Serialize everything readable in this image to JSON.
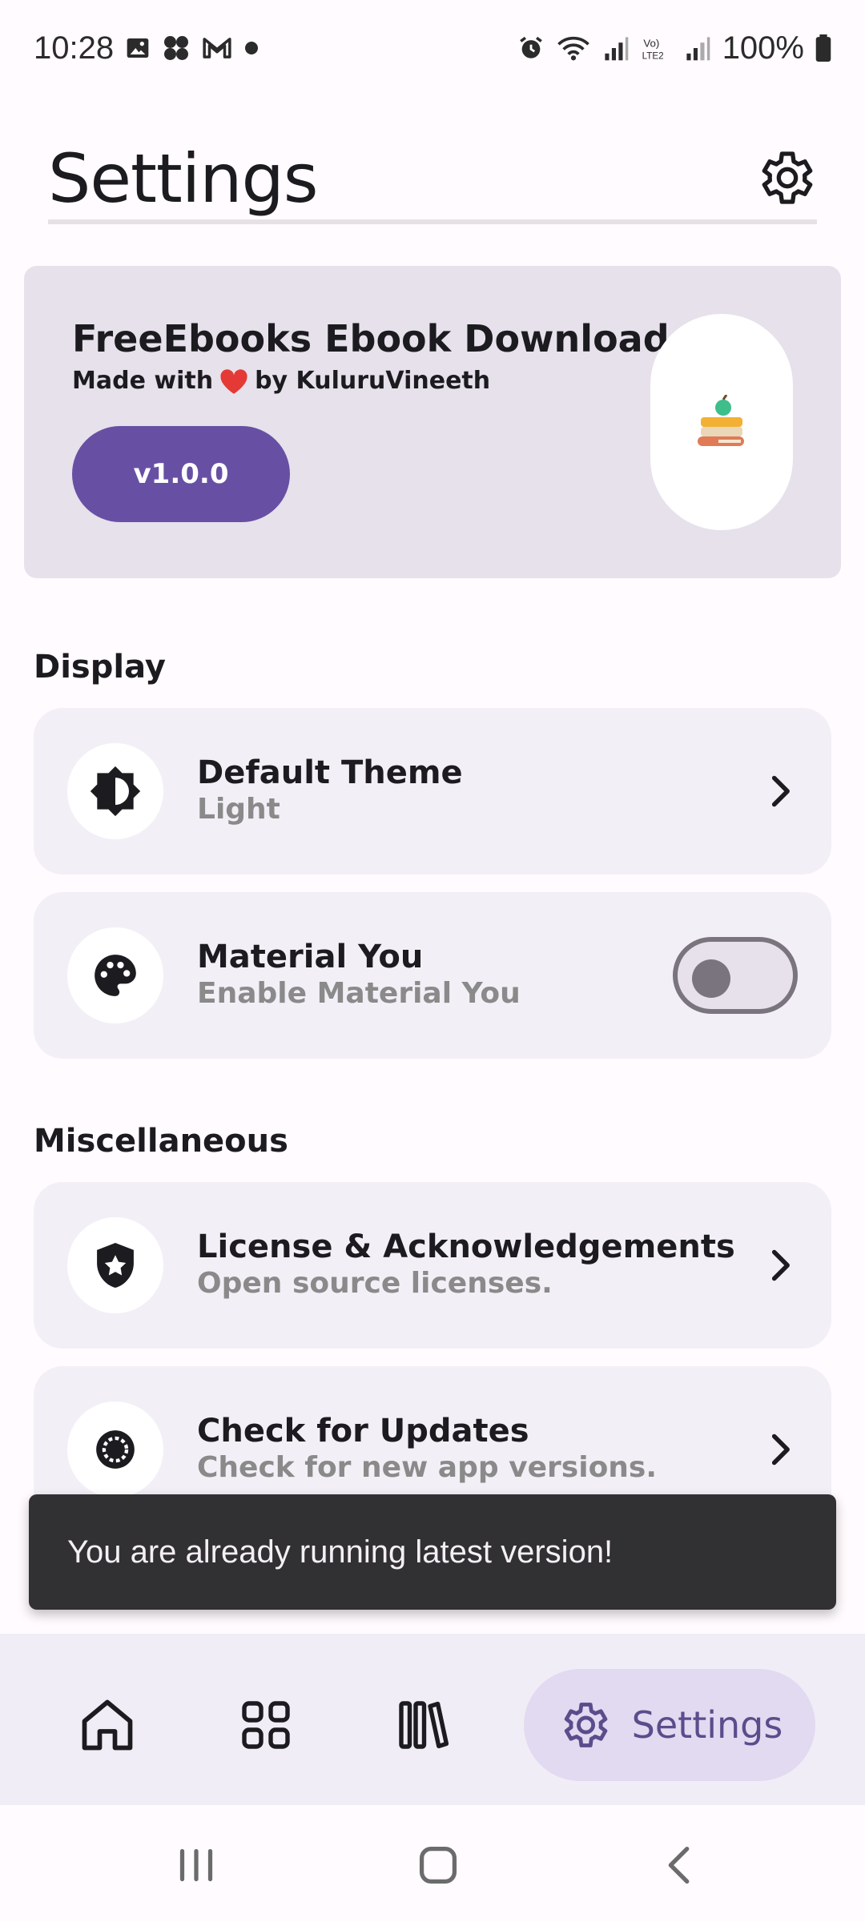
{
  "status_bar": {
    "time": "10:28",
    "battery": "100%",
    "left_icons": [
      "gallery-icon",
      "pinwheel-icon",
      "gmail-icon",
      "dot-icon"
    ],
    "right_icons": [
      "alarm-icon",
      "wifi-icon",
      "signal-r-icon",
      "volte-icon",
      "signal-icon",
      "battery-icon"
    ]
  },
  "header": {
    "title": "Settings"
  },
  "app_card": {
    "name": "FreeEbooks Ebook Downloader",
    "credit_prefix": "Made with",
    "credit_suffix": "by KuluruVineeth",
    "version": "v1.0.0"
  },
  "sections": {
    "display": {
      "title": "Display",
      "items": [
        {
          "title": "Default Theme",
          "subtitle": "Light",
          "icon": "brightness-icon",
          "control": "chevron"
        },
        {
          "title": "Material You",
          "subtitle": "Enable Material You",
          "icon": "palette-icon",
          "control": "toggle",
          "toggle_on": false
        }
      ]
    },
    "misc": {
      "title": "Miscellaneous",
      "items": [
        {
          "title": "License & Acknowledgements",
          "subtitle": "Open source licenses.",
          "icon": "shield-star-icon",
          "control": "chevron"
        },
        {
          "title": "Check for Updates",
          "subtitle": "Check for new app versions.",
          "icon": "update-icon",
          "control": "chevron"
        }
      ]
    }
  },
  "snackbar": {
    "message": "You are already running latest version!"
  },
  "bottom_nav": {
    "items": [
      {
        "icon": "home-icon"
      },
      {
        "icon": "categories-icon"
      },
      {
        "icon": "library-icon"
      },
      {
        "icon": "settings-icon",
        "label": "Settings",
        "active": true
      }
    ]
  },
  "colors": {
    "primary": "#6750A4",
    "card_bg": "#E6E1EB",
    "row_bg": "#F3EFF6",
    "snackbar_bg": "#313033",
    "nav_bg": "#F1EDF7",
    "nav_active_bg": "#E2DAF0"
  }
}
